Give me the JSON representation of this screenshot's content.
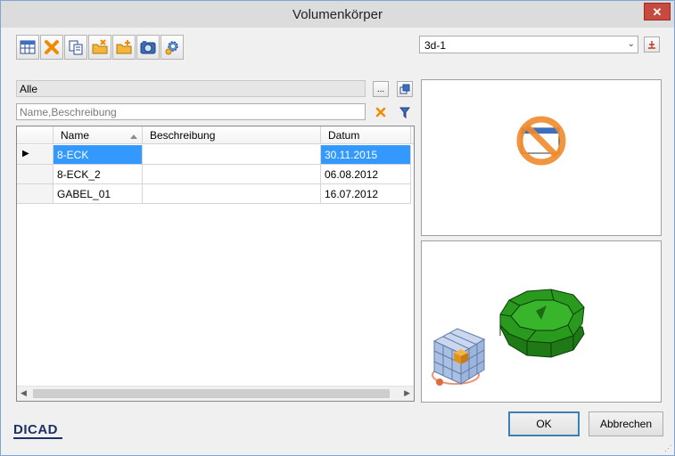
{
  "window": {
    "title": "Volumenkörper",
    "close_glyph": "✕"
  },
  "toolbar": {
    "buttons": [
      {
        "icon": "table-icon"
      },
      {
        "icon": "delete-x-icon"
      },
      {
        "icon": "copy-icon"
      },
      {
        "icon": "folder-import-icon"
      },
      {
        "icon": "folder-add-icon"
      },
      {
        "icon": "camera-icon"
      },
      {
        "icon": "settings-gear-icon"
      }
    ]
  },
  "catalog_select": {
    "value": "3d-1",
    "arrow": "⌄"
  },
  "filter": {
    "value": "Alle",
    "browse_label": "...",
    "open_icon": "open-window-icon"
  },
  "search": {
    "placeholder": "Name,Beschreibung",
    "clear_icon": "clear-x-icon",
    "filter_icon": "funnel-icon"
  },
  "grid": {
    "columns": [
      {
        "label": "Name",
        "sort": "ascending"
      },
      {
        "label": "Beschreibung"
      },
      {
        "label": "Datum"
      }
    ],
    "rows": [
      {
        "name": "8-ECK",
        "description": "",
        "date": "30.11.2015",
        "selected": true
      },
      {
        "name": "8-ECK_2",
        "description": "",
        "date": "06.08.2012",
        "selected": false
      },
      {
        "name": "GABEL_01",
        "description": "",
        "date": "16.07.2012",
        "selected": false
      }
    ],
    "current_row_marker": "▶"
  },
  "preview": {
    "top_icon": "no-preview-icon",
    "bottom": "3d-octagon-preview"
  },
  "logo": {
    "text": "DICAD"
  },
  "buttons": {
    "ok": "OK",
    "cancel": "Abbrechen"
  },
  "colors": {
    "selection": "#3399ff",
    "octagon": "#2a9a1e",
    "title_bar": "#dcdcdc"
  }
}
